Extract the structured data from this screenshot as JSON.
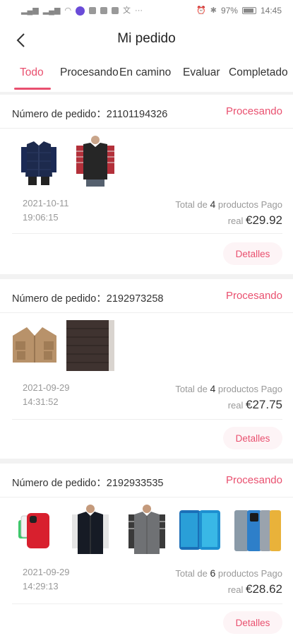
{
  "status_bar": {
    "battery": "97%",
    "time": "14:45"
  },
  "header": {
    "title": "Mi pedido"
  },
  "tabs": [
    {
      "label": "Todo"
    },
    {
      "label": "Procesando"
    },
    {
      "label": "En camino"
    },
    {
      "label": "Evaluar"
    },
    {
      "label": "Completado"
    }
  ],
  "orders": [
    {
      "number_label": "Número de pedido：21101194326",
      "status": "Procesando",
      "date": "2021-10-11",
      "time": "19:06:15",
      "total_prefix": "Total de ",
      "total_count": "4",
      "total_suffix": " productos Pago",
      "paid_label": "real ",
      "price": "€29.92",
      "details_label": "Detalles",
      "products": [
        "navy-puffer-vest",
        "black-fleece-vest"
      ]
    },
    {
      "number_label": "Número de pedido：2192973258",
      "status": "Procesando",
      "date": "2021-09-29",
      "time": "14:31:52",
      "total_prefix": "Total de ",
      "total_count": "4",
      "total_suffix": " productos Pago",
      "paid_label": "real ",
      "price": "€27.75",
      "details_label": "Detalles",
      "products": [
        "khaki-utility-vest",
        "brown-quilted-vest"
      ]
    },
    {
      "number_label": "Número de pedido：2192933535",
      "status": "Procesando",
      "date": "2021-09-29",
      "time": "14:29:13",
      "total_prefix": "Total de ",
      "total_count": "6",
      "total_suffix": " productos Pago",
      "paid_label": "real ",
      "price": "€28.62",
      "details_label": "Detalles",
      "products": [
        "red-smartphone",
        "black-vest-man",
        "grey-vest-man",
        "blue-smartphone",
        "multicolor-smartphones"
      ]
    }
  ],
  "colors": {
    "accent": "#e9506f",
    "muted": "#999999",
    "divider": "#eeeeee"
  }
}
